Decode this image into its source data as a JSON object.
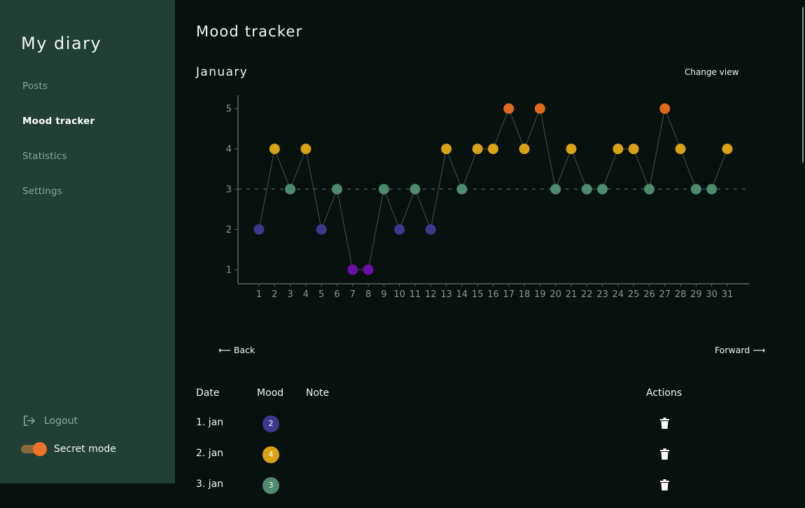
{
  "app": {
    "title": "My diary"
  },
  "sidebar": {
    "items": [
      {
        "label": "Posts",
        "active": false
      },
      {
        "label": "Mood tracker",
        "active": true
      },
      {
        "label": "Statistics",
        "active": false
      },
      {
        "label": "Settings",
        "active": false
      }
    ],
    "logout_label": "Logout",
    "secret_mode": {
      "label": "Secret mode",
      "enabled": true
    }
  },
  "main": {
    "title": "Mood tracker",
    "month": "January",
    "change_view_label": "Change view",
    "back_label": "⟵ Back",
    "forward_label": "Forward ⟶"
  },
  "mood_colors": {
    "1": "#6a0fa8",
    "2": "#3a3a8c",
    "3": "#4d8a6e",
    "4": "#d9a116",
    "5": "#e06a1c"
  },
  "chart_data": {
    "type": "line",
    "x": [
      1,
      2,
      3,
      4,
      5,
      6,
      7,
      8,
      9,
      10,
      11,
      12,
      13,
      14,
      15,
      16,
      17,
      18,
      19,
      20,
      21,
      22,
      23,
      24,
      25,
      26,
      27,
      28,
      29,
      30,
      31
    ],
    "values": [
      2,
      4,
      3,
      4,
      2,
      3,
      1,
      1,
      3,
      2,
      3,
      2,
      4,
      3,
      4,
      4,
      5,
      4,
      5,
      3,
      4,
      3,
      3,
      4,
      4,
      3,
      5,
      4,
      3,
      3,
      4
    ],
    "yticks": [
      1,
      2,
      3,
      4,
      5
    ],
    "ylim": [
      1,
      5
    ],
    "reference_line": 3,
    "xlabel": "",
    "ylabel": ""
  },
  "table": {
    "headers": {
      "date": "Date",
      "mood": "Mood",
      "note": "Note",
      "actions": "Actions"
    },
    "rows": [
      {
        "date": "1. jan",
        "mood": 2,
        "note": ""
      },
      {
        "date": "2. jan",
        "mood": 4,
        "note": ""
      },
      {
        "date": "3. jan",
        "mood": 3,
        "note": ""
      }
    ]
  }
}
